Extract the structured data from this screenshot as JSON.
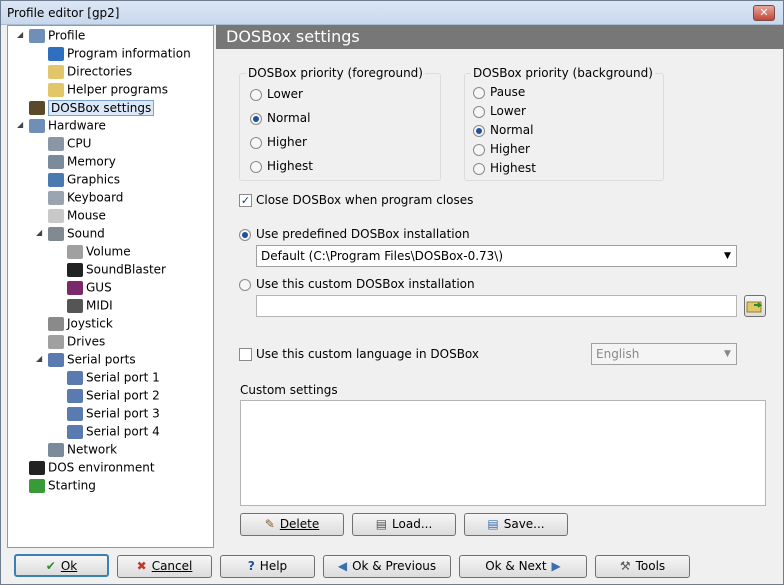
{
  "window": {
    "title": "Profile editor [gp2]",
    "close_label": "✕"
  },
  "tree": {
    "items": [
      {
        "label": "Profile",
        "icon": "profile-icon"
      },
      {
        "label": "Program information",
        "icon": "info-icon"
      },
      {
        "label": "Directories",
        "icon": "folder-icon"
      },
      {
        "label": "Helper programs",
        "icon": "folder-icon"
      },
      {
        "label": "DOSBox settings",
        "icon": "dosbox-icon"
      },
      {
        "label": "Hardware",
        "icon": "hardware-icon"
      },
      {
        "label": "CPU",
        "icon": "cpu-icon"
      },
      {
        "label": "Memory",
        "icon": "memory-icon"
      },
      {
        "label": "Graphics",
        "icon": "graphics-icon"
      },
      {
        "label": "Keyboard",
        "icon": "keyboard-icon"
      },
      {
        "label": "Mouse",
        "icon": "mouse-icon"
      },
      {
        "label": "Sound",
        "icon": "speaker-icon"
      },
      {
        "label": "Volume",
        "icon": "volume-icon"
      },
      {
        "label": "SoundBlaster",
        "icon": "soundblaster-icon"
      },
      {
        "label": "GUS",
        "icon": "gus-icon"
      },
      {
        "label": "MIDI",
        "icon": "midi-icon"
      },
      {
        "label": "Joystick",
        "icon": "joystick-icon"
      },
      {
        "label": "Drives",
        "icon": "drive-icon"
      },
      {
        "label": "Serial ports",
        "icon": "serial-port-icon"
      },
      {
        "label": "Serial port 1",
        "icon": "serial-port-icon"
      },
      {
        "label": "Serial port 2",
        "icon": "serial-port-icon"
      },
      {
        "label": "Serial port 3",
        "icon": "serial-port-icon"
      },
      {
        "label": "Serial port 4",
        "icon": "serial-port-icon"
      },
      {
        "label": "Network",
        "icon": "network-icon"
      },
      {
        "label": "DOS environment",
        "icon": "terminal-icon"
      },
      {
        "label": "Starting",
        "icon": "play-icon"
      }
    ],
    "selected": "DOSBox settings"
  },
  "panel": {
    "title": "DOSBox settings",
    "fg": {
      "label": "DOSBox priority (foreground)",
      "options": [
        "Lower",
        "Normal",
        "Higher",
        "Highest"
      ],
      "selected": "Normal"
    },
    "bg": {
      "label": "DOSBox priority (background)",
      "options": [
        "Pause",
        "Lower",
        "Normal",
        "Higher",
        "Highest"
      ],
      "selected": "Normal"
    },
    "close_dosbox": {
      "label": "Close DOSBox when program closes",
      "checked": true
    },
    "predefined": {
      "label": "Use predefined DOSBox installation",
      "value": "Default (C:\\Program Files\\DOSBox-0.73\\)"
    },
    "custom_install": {
      "label": "Use this custom DOSBox installation",
      "value": ""
    },
    "language": {
      "label": "Use this custom language in DOSBox",
      "value": "English",
      "checked": false
    },
    "custom_settings": {
      "label": "Custom settings",
      "value": ""
    },
    "buttons": {
      "delete": "Delete",
      "load": "Load...",
      "save": "Save..."
    }
  },
  "footer": {
    "ok": "Ok",
    "cancel": "Cancel",
    "help": "Help",
    "ok_previous": "Ok & Previous",
    "ok_next": "Ok & Next",
    "tools": "Tools"
  },
  "colors": {
    "header_bg": "#777777",
    "selection": "#dbe8f8",
    "radio_dot": "#1f4fa3"
  }
}
